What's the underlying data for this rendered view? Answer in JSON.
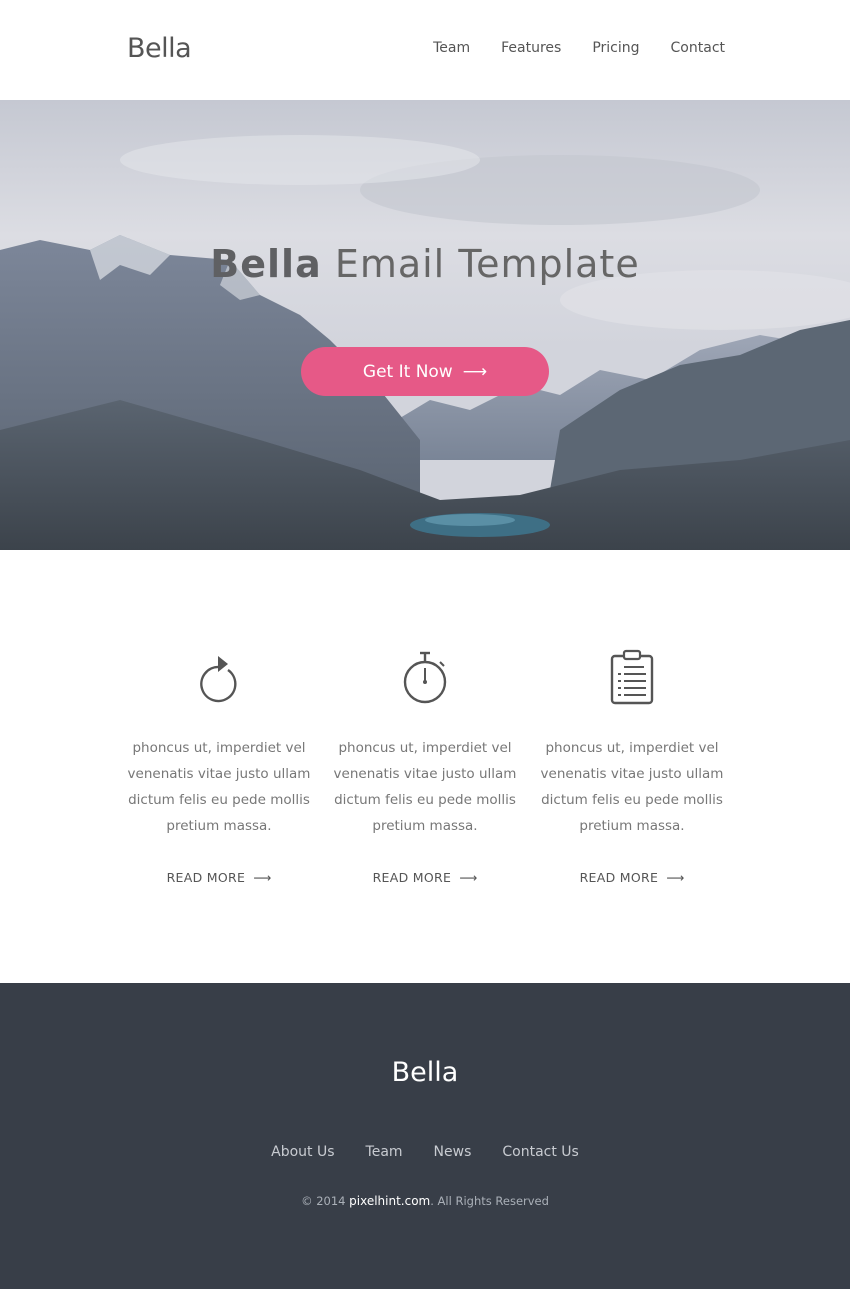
{
  "header": {
    "logo": "Bella",
    "nav": [
      "Team",
      "Features",
      "Pricing",
      "Contact"
    ]
  },
  "hero": {
    "title_strong": "Bella",
    "title_light": "Email Template",
    "cta_label": "Get It Now",
    "cta_arrow": "⟶"
  },
  "features": [
    {
      "icon": "refresh-icon",
      "text": "phoncus ut, imperdiet vel venenatis vitae justo ullam dictum felis eu pede mollis pretium massa.",
      "link": "READ MORE"
    },
    {
      "icon": "stopwatch-icon",
      "text": "phoncus ut, imperdiet vel venenatis vitae justo ullam dictum felis eu pede mollis pretium massa.",
      "link": "READ MORE"
    },
    {
      "icon": "clipboard-list-icon",
      "text": "phoncus ut, imperdiet vel venenatis vitae justo ullam dictum felis eu pede mollis pretium massa.",
      "link": "READ MORE"
    }
  ],
  "footer": {
    "logo": "Bella",
    "nav": [
      "About Us",
      "Team",
      "News",
      "Contact Us"
    ],
    "copyright_prefix": "© 2014",
    "copyright_site": "pixelhint.com",
    "copyright_suffix": ". All Rights Reserved"
  },
  "colors": {
    "accent": "#e65987",
    "footer_bg": "#383e48",
    "text": "#555555"
  }
}
